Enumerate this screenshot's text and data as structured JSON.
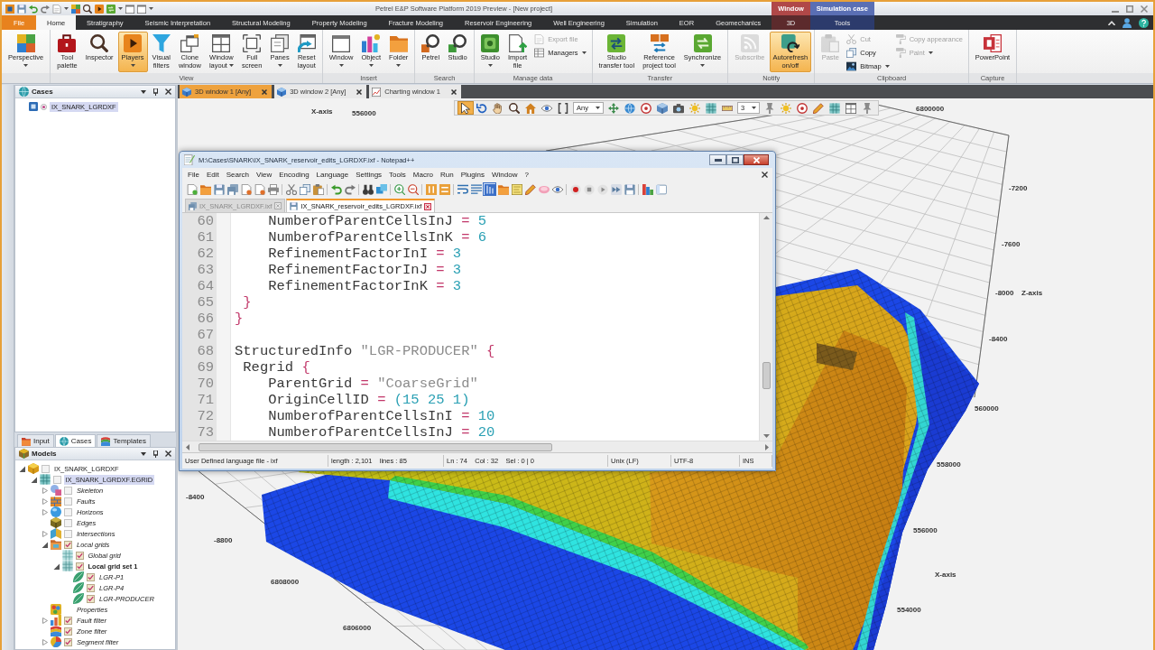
{
  "app": {
    "title": "Petrel E&P Software Platform 2019 Preview - [New project]",
    "context_groups": [
      {
        "label": "Window",
        "color": "#b04848"
      },
      {
        "label": "Simulation case",
        "color": "#5a6fb4"
      }
    ]
  },
  "ribbon": {
    "tabs": [
      {
        "label": "File",
        "kind": "file",
        "selected": false
      },
      {
        "label": "Home",
        "kind": "tab",
        "selected": true
      },
      {
        "label": "Stratigraphy",
        "kind": "tab",
        "selected": false
      },
      {
        "label": "Seismic Interpretation",
        "kind": "tab",
        "selected": false
      },
      {
        "label": "Structural Modeling",
        "kind": "tab",
        "selected": false
      },
      {
        "label": "Property Modeling",
        "kind": "tab",
        "selected": false
      },
      {
        "label": "Fracture Modeling",
        "kind": "tab",
        "selected": false
      },
      {
        "label": "Reservoir Engineering",
        "kind": "tab",
        "selected": false
      },
      {
        "label": "Well Engineering",
        "kind": "tab",
        "selected": false
      },
      {
        "label": "Simulation",
        "kind": "tab",
        "selected": false
      },
      {
        "label": "EOR",
        "kind": "tab",
        "selected": false
      },
      {
        "label": "Geomechanics",
        "kind": "tab",
        "selected": false
      },
      {
        "label": "3D",
        "kind": "context",
        "color": "#5c2a2c",
        "selected": false
      },
      {
        "label": "Tools",
        "kind": "context",
        "color": "#2c3b6c",
        "selected": false
      }
    ],
    "groups": [
      {
        "items": [
          {
            "kind": "tiles",
            "label": "Perspective",
            "dropdown": true,
            "pressed": false,
            "disabled": false
          }
        ]
      },
      {
        "label": "View",
        "items": [
          {
            "kind": "toolbox",
            "label": "Tool\npalette",
            "dropdown": false,
            "pressed": false,
            "disabled": false
          },
          {
            "kind": "inspector",
            "label": "Inspector",
            "dropdown": false,
            "pressed": false,
            "disabled": false
          },
          {
            "kind": "play",
            "label": "Players",
            "dropdown": true,
            "pressed": true,
            "disabled": false
          },
          {
            "kind": "funnel",
            "label": "Visual\nfilters",
            "dropdown": false,
            "pressed": false,
            "disabled": false
          },
          {
            "kind": "windows",
            "label": "Clone\nwindow",
            "dropdown": false,
            "pressed": false,
            "disabled": false
          },
          {
            "kind": "layout",
            "label": "Window\nlayout",
            "dropdown": true,
            "pressed": false,
            "disabled": false
          },
          {
            "kind": "fullscreen",
            "label": "Full\nscreen",
            "dropdown": false,
            "pressed": false,
            "disabled": false
          },
          {
            "kind": "pages",
            "label": "Panes",
            "dropdown": true,
            "pressed": false,
            "disabled": false
          },
          {
            "kind": "reset",
            "label": "Reset\nlayout",
            "dropdown": false,
            "pressed": false,
            "disabled": false
          }
        ]
      },
      {
        "label": "Insert",
        "items": [
          {
            "kind": "window",
            "label": "Window",
            "dropdown": true,
            "pressed": false,
            "disabled": false
          },
          {
            "kind": "blocks",
            "label": "Object",
            "dropdown": true,
            "pressed": false,
            "disabled": false
          },
          {
            "kind": "folder",
            "label": "Folder",
            "dropdown": true,
            "pressed": false,
            "disabled": false
          }
        ]
      },
      {
        "label": "Search",
        "items": [
          {
            "kind": "searchp",
            "label": "Petrel",
            "dropdown": false,
            "pressed": false,
            "disabled": false
          },
          {
            "kind": "searchs",
            "label": "Studio",
            "dropdown": false,
            "pressed": false,
            "disabled": false
          }
        ]
      },
      {
        "label": "Manage data",
        "items": [
          {
            "kind": "studio",
            "label": "Studio",
            "dropdown": true,
            "pressed": false,
            "disabled": false
          },
          {
            "kind": "import",
            "label": "Import\nfile",
            "dropdown": false,
            "pressed": false,
            "disabled": false
          },
          {
            "buttons": [
              {
                "kind": "document",
                "label": "Export file",
                "dropdown": false,
                "disabled": true
              },
              {
                "kind": "table",
                "label": "Managers",
                "dropdown": true,
                "disabled": false
              }
            ]
          }
        ]
      },
      {
        "label": "Transfer",
        "items": [
          {
            "kind": "transferg",
            "label": "Studio\ntransfer tool",
            "dropdown": false,
            "pressed": false,
            "disabled": false
          },
          {
            "kind": "transfero",
            "label": "Reference\nproject tool",
            "dropdown": false,
            "pressed": false,
            "disabled": false
          },
          {
            "kind": "sync",
            "label": "Synchronize",
            "dropdown": true,
            "pressed": false,
            "disabled": false
          }
        ]
      },
      {
        "label": "Notify",
        "items": [
          {
            "kind": "rss",
            "label": "Subscribe",
            "dropdown": false,
            "pressed": false,
            "disabled": true
          },
          {
            "kind": "refresh",
            "label": "Autorefresh\non/off",
            "dropdown": false,
            "pressed": true,
            "disabled": false
          }
        ]
      },
      {
        "label": "Clipboard",
        "items": [
          {
            "kind": "clipboard",
            "label": "Paste",
            "dropdown": false,
            "pressed": false,
            "disabled": true
          },
          {
            "buttons": [
              {
                "kind": "scissors",
                "label": "Cut",
                "dropdown": false,
                "disabled": true
              },
              {
                "kind": "copy",
                "label": "Copy",
                "dropdown": false,
                "disabled": false
              },
              {
                "kind": "image",
                "label": "Bitmap",
                "dropdown": true,
                "disabled": false
              }
            ]
          },
          {
            "buttons": [
              {
                "kind": "roller",
                "label": "Copy appearance",
                "dropdown": false,
                "disabled": true
              },
              {
                "kind": "roller",
                "label": "Paint",
                "dropdown": true,
                "disabled": true
              }
            ]
          }
        ]
      },
      {
        "label": "Capture",
        "items": [
          {
            "kind": "presentation",
            "label": "PowerPoint",
            "dropdown": false,
            "pressed": false,
            "disabled": false
          }
        ]
      }
    ]
  },
  "explorer": {
    "cases": {
      "title": "Cases",
      "items": [
        {
          "label": "IX_SNARK_LGRDXF",
          "selected": true
        }
      ]
    },
    "tabs": [
      {
        "label": "Input",
        "kind": "input",
        "selected": false
      },
      {
        "label": "Cases",
        "kind": "cases",
        "selected": true
      },
      {
        "label": "Templates",
        "kind": "templates",
        "selected": false
      }
    ],
    "models": {
      "title": "Models",
      "tree": [
        {
          "label": "IX_SNARK_LGRDXF",
          "kind": "project",
          "checked": false,
          "expanded": true,
          "selected": false,
          "active": false,
          "children": [
            {
              "label": "IX_SNARK_LGRDXF.EGRID",
              "kind": "grid",
              "checked": false,
              "expanded": true,
              "selected": true,
              "active": false,
              "children": [
                {
                  "label": "Skeleton",
                  "kind": "skeleton",
                  "checked": false,
                  "expanded": false,
                  "selected": false,
                  "active": false
                },
                {
                  "label": "Faults",
                  "kind": "faults",
                  "checked": false,
                  "expanded": false,
                  "selected": false,
                  "active": false
                },
                {
                  "label": "Horizons",
                  "kind": "horizons",
                  "checked": false,
                  "expanded": false,
                  "selected": false,
                  "active": false
                },
                {
                  "label": "Edges",
                  "kind": "edges",
                  "checked": false,
                  "selected": false,
                  "active": false
                },
                {
                  "label": "Intersections",
                  "kind": "intersections",
                  "checked": false,
                  "expanded": false,
                  "selected": false,
                  "active": false
                },
                {
                  "label": "Local grids",
                  "kind": "localgrids",
                  "checked": true,
                  "expanded": true,
                  "selected": false,
                  "active": false,
                  "children": [
                    {
                      "label": "Global grid",
                      "kind": "globalgrid",
                      "checked": true,
                      "selected": false,
                      "active": false
                    },
                    {
                      "label": "Local grid set 1",
                      "kind": "gridset",
                      "checked": true,
                      "expanded": true,
                      "selected": false,
                      "active": true,
                      "children": [
                        {
                          "label": "LGR-P1",
                          "kind": "lgr",
                          "checked": true,
                          "selected": false,
                          "active": false
                        },
                        {
                          "label": "LGR-P4",
                          "kind": "lgr",
                          "checked": true,
                          "selected": false,
                          "active": false
                        },
                        {
                          "label": "LGR-PRODUCER",
                          "kind": "lgr",
                          "checked": true,
                          "selected": false,
                          "active": false
                        }
                      ]
                    }
                  ]
                },
                {
                  "label": "Properties",
                  "kind": "properties",
                  "selected": false,
                  "active": false
                },
                {
                  "label": "Fault filter",
                  "kind": "faultfilter",
                  "checked": true,
                  "expanded": false,
                  "selected": false,
                  "active": false
                },
                {
                  "label": "Zone filter",
                  "kind": "zonefilter",
                  "checked": true,
                  "selected": false,
                  "active": false
                },
                {
                  "label": "Segment filter",
                  "kind": "segmentfilter",
                  "checked": true,
                  "expanded": false,
                  "selected": false,
                  "active": false
                }
              ]
            }
          ]
        }
      ]
    }
  },
  "workspace": {
    "tabs": [
      {
        "label": "3D window 1 [Any]",
        "kind": "view3d",
        "selected": true
      },
      {
        "label": "3D window 2 [Any]",
        "kind": "view3d",
        "selected": false
      },
      {
        "label": "Charting window 1",
        "kind": "chart",
        "selected": false
      }
    ],
    "toolbar": [
      {
        "kind": "cursor",
        "selected": true
      },
      {
        "kind": "rotate",
        "selected": false
      },
      {
        "kind": "hand",
        "selected": false
      },
      {
        "kind": "inspector",
        "selected": false
      },
      {
        "kind": "home",
        "selected": false
      },
      {
        "kind": "eye",
        "selected": false
      },
      {
        "kind": "bracket",
        "selected": false
      },
      {
        "kind": "dropdown",
        "value": "Any"
      },
      {
        "kind": "navigate",
        "selected": false
      },
      {
        "kind": "globe",
        "selected": false
      },
      {
        "kind": "target",
        "selected": false
      },
      {
        "kind": "cube",
        "selected": false
      },
      {
        "kind": "camera",
        "selected": false
      },
      {
        "kind": "sun",
        "selected": false
      },
      {
        "kind": "grid",
        "selected": false
      },
      {
        "kind": "ruler",
        "selected": false
      },
      {
        "kind": "dropdown",
        "value": "3"
      },
      {
        "kind": "pin",
        "selected": false
      },
      {
        "kind": "sun",
        "selected": false
      },
      {
        "kind": "target",
        "selected": false
      },
      {
        "kind": "pencil",
        "selected": false
      },
      {
        "kind": "grid",
        "selected": false
      },
      {
        "kind": "layout",
        "selected": false
      },
      {
        "kind": "pin",
        "selected": false
      }
    ],
    "axis_labels": [
      "X-axis",
      "556000",
      "6800000",
      "-7200",
      "-7600",
      "-8000",
      "Z-axis",
      "-8400",
      "560000",
      "558000",
      "556000",
      "X-axis",
      "554000",
      "-8400",
      "-8800",
      "6808000",
      "6806000"
    ]
  },
  "editor": {
    "title": "M:\\Cases\\SNARK\\IX_SNARK_reservoir_edits_LGRDXF.ixf - Notepad++",
    "menu": [
      "File",
      "Edit",
      "Search",
      "View",
      "Encoding",
      "Language",
      "Settings",
      "Tools",
      "Macro",
      "Run",
      "Plugins",
      "Window",
      "?"
    ],
    "toolbar": [
      {
        "kind": "new",
        "selected": false
      },
      {
        "kind": "folder",
        "selected": false
      },
      {
        "kind": "floppy",
        "selected": false
      },
      {
        "kind": "floppies",
        "selected": false
      },
      {
        "kind": "closedoc",
        "selected": false
      },
      {
        "kind": "closedoc",
        "selected": false
      },
      {
        "kind": "printer",
        "selected": false
      },
      {
        "kind": "separator"
      },
      {
        "kind": "scissors",
        "selected": false
      },
      {
        "kind": "copy",
        "selected": false
      },
      {
        "kind": "paste",
        "selected": false
      },
      {
        "kind": "separator"
      },
      {
        "kind": "undo",
        "selected": false
      },
      {
        "kind": "redo",
        "selected": false
      },
      {
        "kind": "separator"
      },
      {
        "kind": "binoculars",
        "selected": false
      },
      {
        "kind": "replace",
        "selected": false
      },
      {
        "kind": "separator"
      },
      {
        "kind": "zoomin",
        "selected": false
      },
      {
        "kind": "zoomout",
        "selected": false
      },
      {
        "kind": "separator"
      },
      {
        "kind": "syncv",
        "selected": false
      },
      {
        "kind": "synch",
        "selected": false
      },
      {
        "kind": "separator"
      },
      {
        "kind": "wrap",
        "selected": false
      },
      {
        "kind": "lines",
        "selected": false
      },
      {
        "kind": "indent",
        "selected": true
      },
      {
        "kind": "folder",
        "selected": false
      },
      {
        "kind": "docmap",
        "selected": false
      },
      {
        "kind": "pencil",
        "selected": false
      },
      {
        "kind": "eraser",
        "selected": false
      },
      {
        "kind": "eye",
        "selected": false
      },
      {
        "kind": "separator"
      },
      {
        "kind": "record",
        "selected": false
      },
      {
        "kind": "stop",
        "selected": false
      },
      {
        "kind": "playm",
        "selected": false
      },
      {
        "kind": "playmulti",
        "selected": false
      },
      {
        "kind": "floppy",
        "selected": false
      },
      {
        "kind": "separator"
      },
      {
        "kind": "colorbars",
        "selected": false
      },
      {
        "kind": "panel",
        "selected": false
      }
    ],
    "tabs": [
      {
        "label": "IX_SNARK_LGRDXF.ixf",
        "selected": false
      },
      {
        "label": "IX_SNARK_reservoir_edits_LGRDXF.ixf",
        "selected": true
      }
    ],
    "lines": [
      {
        "number": "60",
        "tokens": [
          {
            "text": "    NumberofParentCellsInJ ",
            "kind": "plain"
          },
          {
            "text": "=",
            "kind": "operator"
          },
          {
            "text": " 5",
            "kind": "number"
          }
        ]
      },
      {
        "number": "61",
        "tokens": [
          {
            "text": "    NumberofParentCellsInK ",
            "kind": "plain"
          },
          {
            "text": "=",
            "kind": "operator"
          },
          {
            "text": " 6",
            "kind": "number"
          }
        ]
      },
      {
        "number": "62",
        "tokens": [
          {
            "text": "    RefinementFactorInI ",
            "kind": "plain"
          },
          {
            "text": "=",
            "kind": "operator"
          },
          {
            "text": " 3",
            "kind": "number"
          }
        ]
      },
      {
        "number": "63",
        "tokens": [
          {
            "text": "    RefinementFactorInJ ",
            "kind": "plain"
          },
          {
            "text": "=",
            "kind": "operator"
          },
          {
            "text": " 3",
            "kind": "number"
          }
        ]
      },
      {
        "number": "64",
        "tokens": [
          {
            "text": "    RefinementFactorInK ",
            "kind": "plain"
          },
          {
            "text": "=",
            "kind": "operator"
          },
          {
            "text": " 3",
            "kind": "number"
          }
        ]
      },
      {
        "number": "65",
        "tokens": [
          {
            "text": " }",
            "kind": "operator"
          }
        ]
      },
      {
        "number": "66",
        "tokens": [
          {
            "text": "}",
            "kind": "operator"
          }
        ]
      },
      {
        "number": "67"
      },
      {
        "number": "68",
        "tokens": [
          {
            "text": "StructuredInfo ",
            "kind": "plain"
          },
          {
            "text": "\"LGR-PRODUCER\"",
            "kind": "string"
          },
          {
            "text": " {",
            "kind": "operator"
          }
        ]
      },
      {
        "number": "69",
        "tokens": [
          {
            "text": " Regrid ",
            "kind": "plain"
          },
          {
            "text": "{",
            "kind": "operator"
          }
        ]
      },
      {
        "number": "70",
        "tokens": [
          {
            "text": "    ParentGrid ",
            "kind": "plain"
          },
          {
            "text": "=",
            "kind": "operator"
          },
          {
            "text": " \"CoarseGrid\"",
            "kind": "string"
          }
        ]
      },
      {
        "number": "71",
        "tokens": [
          {
            "text": "    OriginCellID ",
            "kind": "plain"
          },
          {
            "text": "=",
            "kind": "operator"
          },
          {
            "text": " (15 25 1)",
            "kind": "number"
          }
        ]
      },
      {
        "number": "72",
        "tokens": [
          {
            "text": "    NumberofParentCellsInI ",
            "kind": "plain"
          },
          {
            "text": "=",
            "kind": "operator"
          },
          {
            "text": " 10",
            "kind": "number"
          }
        ]
      },
      {
        "number": "73",
        "tokens": [
          {
            "text": "    NumberofParentCellsInJ ",
            "kind": "plain"
          },
          {
            "text": "=",
            "kind": "operator"
          },
          {
            "text": " 20",
            "kind": "number"
          }
        ]
      }
    ],
    "status": [
      "User Defined language file - ixf",
      "length : 2,101    lines : 85",
      "Ln : 74    Col : 32    Sel : 0 | 0",
      "Unix (LF)",
      "UTF-8",
      "INS"
    ]
  }
}
